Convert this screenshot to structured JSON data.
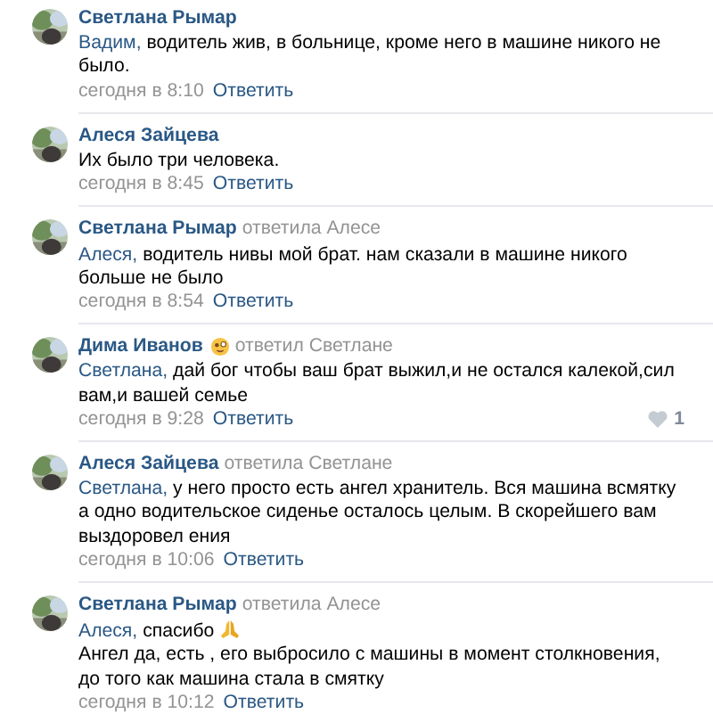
{
  "comments": [
    {
      "author": "Светлана Рымар",
      "addressee": "Вадим,",
      "text": "водитель жив, в больнице, кроме него в машине никого не было.",
      "time": "сегодня в 8:10",
      "reply_label": "Ответить"
    },
    {
      "author": "Алеся Зайцева",
      "text": "Их было три человека.",
      "time": "сегодня в 8:45",
      "reply_label": "Ответить"
    },
    {
      "author": "Светлана Рымар",
      "reply_to": "ответила Алесе",
      "addressee": "Алеся,",
      "text": "водитель нивы мой брат. нам сказали в машине никого больше не было",
      "time": "сегодня в 8:54",
      "reply_label": "Ответить"
    },
    {
      "author": "Дима Иванов",
      "author_badge": true,
      "reply_to": "ответил Светлане",
      "addressee": "Светлана,",
      "text": "дай бог чтобы ваш брат выжил,и не остался калекой,сил вам,и вашей семье",
      "time": "сегодня в 9:28",
      "reply_label": "Ответить",
      "likes": "1"
    },
    {
      "author": "Алеся Зайцева",
      "reply_to": "ответила Светлане",
      "addressee": "Светлана,",
      "text": "у него просто есть ангел хранитель. Вся машина всмятку а одно водительское сиденье осталось целым. В скорейшего вам выздоровел ения",
      "time": "сегодня в 10:06",
      "reply_label": "Ответить"
    },
    {
      "author": "Светлана Рымар",
      "reply_to": "ответила Алесе",
      "addressee": "Алеся,",
      "text": "спасибо",
      "emoji": true,
      "extra_text": "Ангел да, есть , его выбросило с машины в момент столкновения, до того как машина стала в смятку",
      "time": "сегодня в 10:12",
      "reply_label": "Ответить"
    }
  ]
}
